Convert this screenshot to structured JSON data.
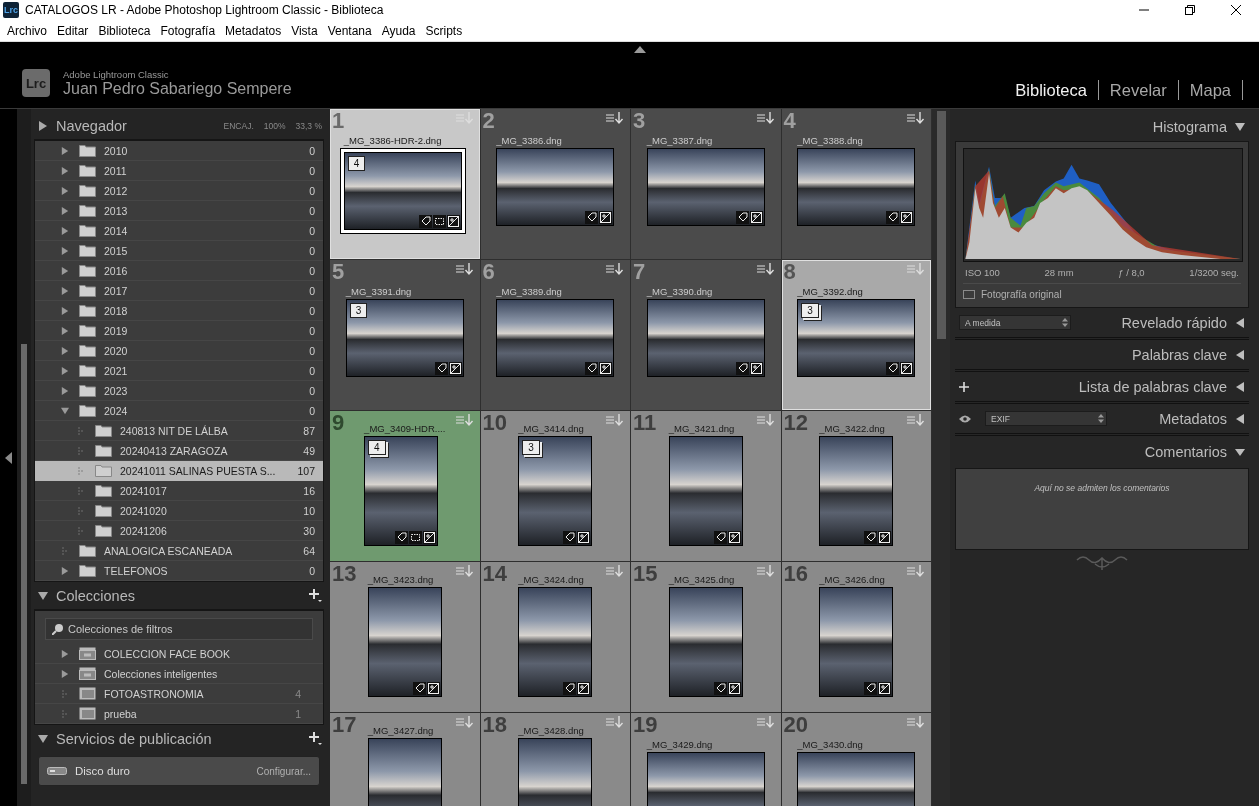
{
  "window": {
    "app_icon": "Lrc",
    "title": "CATALOGOS LR - Adobe Photoshop Lightroom Classic - Biblioteca"
  },
  "menu": [
    "Archivo",
    "Editar",
    "Biblioteca",
    "Fotografía",
    "Metadatos",
    "Vista",
    "Ventana",
    "Ayuda",
    "Scripts"
  ],
  "identity": {
    "logo": "Lrc",
    "product": "Adobe Lightroom Classic",
    "user": "Juan Pedro Sabariego Sempere"
  },
  "modules": [
    {
      "label": "Biblioteca",
      "selected": true
    },
    {
      "label": "Revelar",
      "selected": false
    },
    {
      "label": "Mapa",
      "selected": false
    }
  ],
  "navigator": {
    "title": "Navegador",
    "expanded": false,
    "zooms": [
      "ENCAJ.",
      "100%",
      "33,3 %"
    ]
  },
  "folders": [
    {
      "name": "2010",
      "count": "0",
      "kind": "parent",
      "expanded": false,
      "selected": false
    },
    {
      "name": "2011",
      "count": "0",
      "kind": "parent",
      "expanded": false,
      "selected": false
    },
    {
      "name": "2012",
      "count": "0",
      "kind": "parent",
      "expanded": false,
      "selected": false
    },
    {
      "name": "2013",
      "count": "0",
      "kind": "parent",
      "expanded": false,
      "selected": false
    },
    {
      "name": "2014",
      "count": "0",
      "kind": "parent",
      "expanded": false,
      "selected": false
    },
    {
      "name": "2015",
      "count": "0",
      "kind": "parent",
      "expanded": false,
      "selected": false
    },
    {
      "name": "2016",
      "count": "0",
      "kind": "parent",
      "expanded": false,
      "selected": false
    },
    {
      "name": "2017",
      "count": "0",
      "kind": "parent",
      "expanded": false,
      "selected": false
    },
    {
      "name": "2018",
      "count": "0",
      "kind": "parent",
      "expanded": false,
      "selected": false
    },
    {
      "name": "2019",
      "count": "0",
      "kind": "parent",
      "expanded": false,
      "selected": false
    },
    {
      "name": "2020",
      "count": "0",
      "kind": "parent",
      "expanded": false,
      "selected": false
    },
    {
      "name": "2021",
      "count": "0",
      "kind": "parent",
      "expanded": false,
      "selected": false
    },
    {
      "name": "2023",
      "count": "0",
      "kind": "parent",
      "expanded": false,
      "selected": false
    },
    {
      "name": "2024",
      "count": "0",
      "kind": "parent",
      "expanded": true,
      "selected": false,
      "children": [
        {
          "name": "240813 NIT  DE LÁLBA",
          "count": "87",
          "kind": "leaf",
          "selected": false
        },
        {
          "name": "20240413 ZARAGOZA",
          "count": "49",
          "kind": "leaf",
          "selected": false
        },
        {
          "name": "20241011 SALINAS PUESTA S...",
          "count": "107",
          "kind": "leaf",
          "selected": true
        },
        {
          "name": "20241017",
          "count": "16",
          "kind": "leaf",
          "selected": false
        },
        {
          "name": "20241020",
          "count": "10",
          "kind": "leaf",
          "selected": false
        },
        {
          "name": "20241206",
          "count": "30",
          "kind": "leaf",
          "selected": false
        }
      ]
    },
    {
      "name": "ANALOGICA ESCANEADA",
      "count": "64",
      "kind": "leaf",
      "selected": false
    },
    {
      "name": "TELEFONOS",
      "count": "0",
      "kind": "parent",
      "expanded": false,
      "selected": false
    }
  ],
  "collections": {
    "title": "Colecciones",
    "expanded": true,
    "filter": "Colecciones de filtros",
    "items": [
      {
        "name": "COLECCION FACE BOOK",
        "kind": "set"
      },
      {
        "name": "Colecciones inteligentes",
        "kind": "set"
      },
      {
        "name": "FOTOASTRONOMIA",
        "kind": "collection",
        "count": "4"
      },
      {
        "name": "prueba",
        "kind": "collection",
        "count": "1"
      }
    ]
  },
  "publish": {
    "title": "Servicios de publicación",
    "expanded": true,
    "services": [
      {
        "name": "Disco duro",
        "action": "Configurar..."
      }
    ]
  },
  "grid": {
    "cells": [
      {
        "index": "1",
        "file": "_MG_3386-HDR-2.dng",
        "kind": "landscape",
        "selected": true,
        "active": true,
        "dimmed": false,
        "badge": "4",
        "stacked": false,
        "cropped": true
      },
      {
        "index": "2",
        "file": "_MG_3386.dng",
        "kind": "landscape",
        "selected": false,
        "active": false,
        "dimmed": true,
        "cropped": false
      },
      {
        "index": "3",
        "file": "_MG_3387.dng",
        "kind": "landscape",
        "selected": false,
        "active": false,
        "dimmed": true,
        "cropped": false
      },
      {
        "index": "4",
        "file": "_MG_3388.dng",
        "kind": "landscape",
        "selected": false,
        "active": false,
        "dimmed": true,
        "cropped": false
      },
      {
        "index": "5",
        "file": "_MG_3391.dng",
        "kind": "landscape",
        "selected": false,
        "active": false,
        "dimmed": true,
        "badge": "3",
        "stacked": false,
        "cropped": false
      },
      {
        "index": "6",
        "file": "_MG_3389.dng",
        "kind": "landscape",
        "selected": false,
        "active": false,
        "dimmed": true,
        "cropped": false
      },
      {
        "index": "7",
        "file": "_MG_3390.dng",
        "kind": "landscape",
        "selected": false,
        "active": false,
        "dimmed": true,
        "cropped": false
      },
      {
        "index": "8",
        "file": "_MG_3392.dng",
        "kind": "landscape",
        "selected": true,
        "active": false,
        "dimmed": false,
        "badge": "3",
        "stacked": true,
        "cropped": false
      },
      {
        "index": "9",
        "file": "_MG_3409-HDR....",
        "kind": "portrait",
        "selected": false,
        "active": false,
        "dimmed": false,
        "badge": "4",
        "stacked": true,
        "cropped": true,
        "color": "#6f9a6f"
      },
      {
        "index": "10",
        "file": "_MG_3414.dng",
        "kind": "portrait",
        "selected": false,
        "active": false,
        "dimmed": false,
        "badge": "3",
        "stacked": true,
        "cropped": false
      },
      {
        "index": "11",
        "file": "_MG_3421.dng",
        "kind": "portrait",
        "selected": false,
        "active": false,
        "dimmed": false,
        "cropped": false
      },
      {
        "index": "12",
        "file": "_MG_3422.dng",
        "kind": "portrait",
        "selected": false,
        "active": false,
        "dimmed": false,
        "cropped": false
      },
      {
        "index": "13",
        "file": "_MG_3423.dng",
        "kind": "portrait",
        "selected": false,
        "active": false,
        "dimmed": false,
        "cropped": false
      },
      {
        "index": "14",
        "file": "_MG_3424.dng",
        "kind": "portrait",
        "selected": false,
        "active": false,
        "dimmed": false,
        "cropped": false
      },
      {
        "index": "15",
        "file": "_MG_3425.dng",
        "kind": "portrait",
        "selected": false,
        "active": false,
        "dimmed": false,
        "cropped": false
      },
      {
        "index": "16",
        "file": "_MG_3426.dng",
        "kind": "portrait",
        "selected": false,
        "active": false,
        "dimmed": false,
        "cropped": false
      },
      {
        "index": "17",
        "file": "_MG_3427.dng",
        "kind": "portrait",
        "selected": false,
        "active": false,
        "dimmed": false
      },
      {
        "index": "18",
        "file": "_MG_3428.dng",
        "kind": "portrait",
        "selected": false,
        "active": false,
        "dimmed": false
      },
      {
        "index": "19",
        "file": "_MG_3429.dng",
        "kind": "landscape",
        "selected": false,
        "active": false,
        "dimmed": false
      },
      {
        "index": "20",
        "file": "_MG_3430.dng",
        "kind": "landscape",
        "selected": false,
        "active": false,
        "dimmed": false
      }
    ]
  },
  "histogram": {
    "title": "Histograma",
    "expanded": true,
    "iso": "ISO 100",
    "focal": "28 mm",
    "aperture": "ƒ / 8,0",
    "shutter": "1/3200 seg.",
    "original": "Fotografía original",
    "original_checked": false
  },
  "panels": [
    {
      "kind": "preset",
      "title": "Revelado rápido",
      "preset": "A medida",
      "expanded": false
    },
    {
      "kind": "plain",
      "title": "Palabras clave",
      "expanded": false
    },
    {
      "kind": "add",
      "title": "Lista de palabras clave",
      "expanded": false
    },
    {
      "kind": "view",
      "title": "Metadatos",
      "preset": "EXIF",
      "expanded": false
    },
    {
      "kind": "plain",
      "title": "Comentarios",
      "expanded": true,
      "note": "Aquí no se admiten los comentarios"
    }
  ]
}
